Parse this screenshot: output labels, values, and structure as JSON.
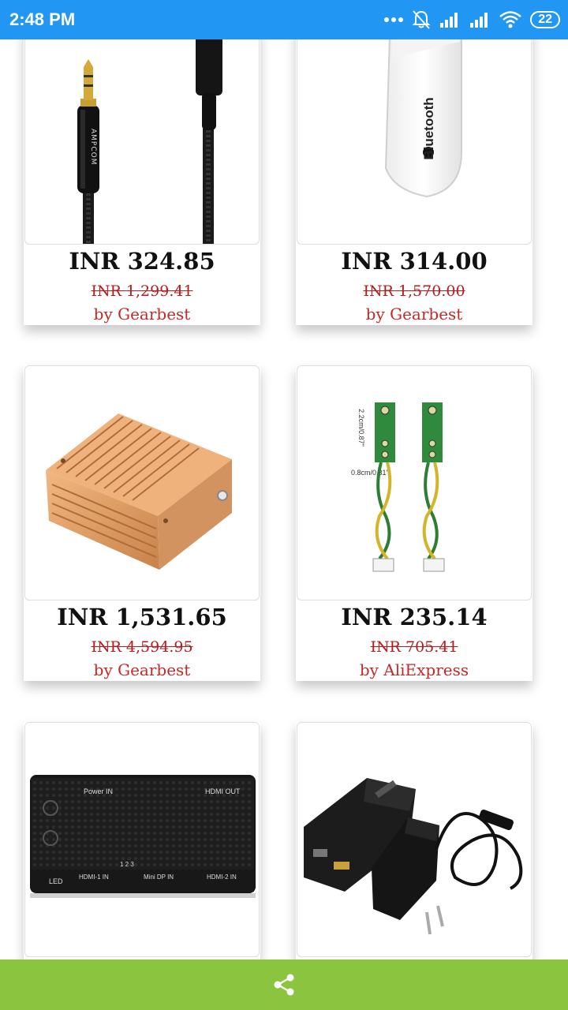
{
  "status_bar": {
    "time": "2:48 PM",
    "battery": "22",
    "icons": [
      "more-dots-icon",
      "notifications-muted-icon",
      "signal-icon",
      "signal-icon",
      "wifi-icon",
      "battery-icon"
    ]
  },
  "products": [
    {
      "price": "INR 324.85",
      "original_price": "INR 1,299.41",
      "seller": "by Gearbest",
      "image": "aux-audio-cable"
    },
    {
      "price": "INR 314.00",
      "original_price": "INR 1,570.00",
      "seller": "by Gearbest",
      "image": "bluetooth-usb-dongle",
      "image_text": "Bluetooth"
    },
    {
      "price": "INR 1,531.65",
      "original_price": "INR 4,594.95",
      "seller": "by Gearbest",
      "image": "copper-phantom-power-box"
    },
    {
      "price": "INR 235.14",
      "original_price": "INR 705.41",
      "seller": "by AliExpress",
      "image": "green-pcb-switch-boards",
      "image_text": [
        "2.2cm/0.87\"",
        "0.8cm/0.31\""
      ]
    },
    {
      "image": "hdmi-switch-box",
      "image_text": [
        "Power IN",
        "HDMI OUT",
        "1 2 3",
        "LED",
        "HDMI-1 IN",
        "Mini DP IN",
        "HDMI-2 IN"
      ]
    },
    {
      "image": "scart-hdmi-converter"
    }
  ],
  "bottom_bar": {
    "icon": "share-icon"
  },
  "colors": {
    "status_bar": "#2196f3",
    "bottom_bar": "#8bc53f",
    "price": "#111111",
    "seller": "#c62828"
  }
}
